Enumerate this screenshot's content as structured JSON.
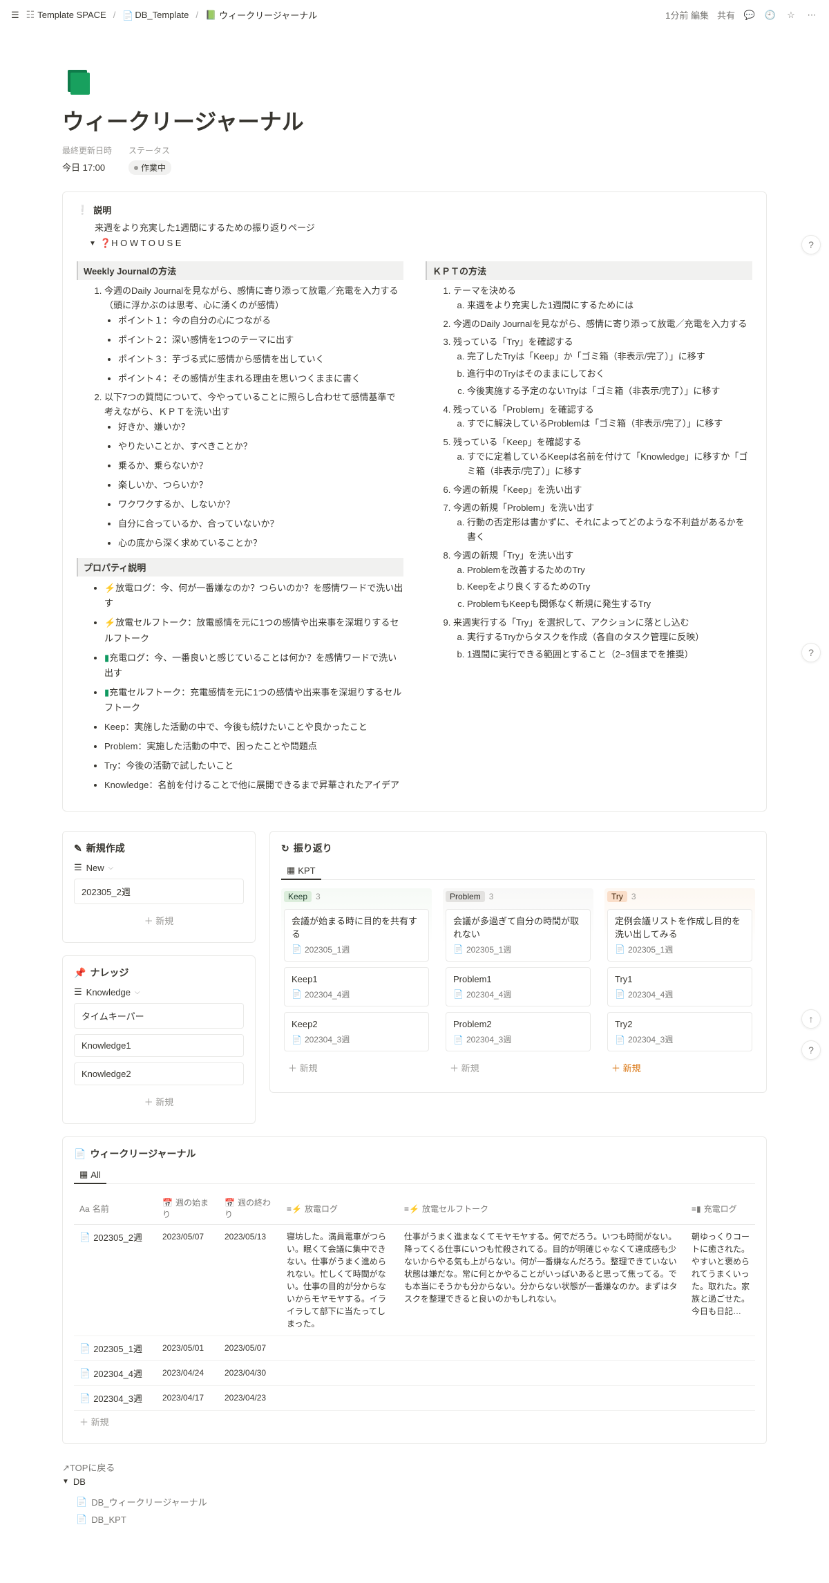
{
  "breadcrumb": [
    {
      "icon": "stack",
      "label": "Template SPACE"
    },
    {
      "icon": "doc",
      "label": "DB_Template"
    },
    {
      "icon": "journal",
      "label": "ウィークリージャーナル"
    }
  ],
  "topbar": {
    "time": "1分前 編集",
    "share": "共有"
  },
  "page": {
    "title": "ウィークリージャーナル"
  },
  "props": {
    "updated_label": "最終更新日時",
    "updated_value": "今日 17:00",
    "status_label": "ステータス",
    "status_value": "作業中"
  },
  "callout": {
    "head": "説明",
    "sub": "来週をより充実した1週間にするための振り返りページ",
    "toggle": "❓H O W  T O  U S E"
  },
  "left": {
    "section1": "Weekly Journalの方法",
    "items1": [
      "今週のDaily Journalを見ながら、感情に寄り添って放電／充電を入力する（頭に浮かぶのは思考、心に湧くのが感情）",
      "以下7つの質問について、今やっていることに照らし合わせて感情基準で考えながら、ＫＰＴを洗い出す"
    ],
    "points": [
      "ポイント１：今の自分の心につながる",
      "ポイント２：深い感情を1つのテーマに出す",
      "ポイント３：芋づる式に感情から感情を出していく",
      "ポイント４：その感情が生まれる理由を思いつくままに書く"
    ],
    "questions": [
      "好きか、嫌いか？",
      "やりたいことか、すべきことか？",
      "乗るか、乗らないか？",
      "楽しいか、つらいか？",
      "ワクワクするか、しないか？",
      "自分に合っているか、合っていないか？",
      "心の底から深く求めていることか？"
    ],
    "section2": "プロパティ説明",
    "props": [
      {
        "pre": "⚡",
        "cls": "bolt",
        "text": "放電ログ：今、何が一番嫌なのか？つらいのか？を感情ワードで洗い出す"
      },
      {
        "pre": "⚡",
        "cls": "bolt",
        "text": "放電セルフトーク：放電感情を元に1つの感情や出来事を深堀りするセルフトーク"
      },
      {
        "pre": "▮",
        "cls": "plug-green",
        "text": "充電ログ：今、一番良いと感じていることは何か？を感情ワードで洗い出す"
      },
      {
        "pre": "▮",
        "cls": "plug-green",
        "text": "充電セルフトーク：充電感情を元に1つの感情や出来事を深堀りするセルフトーク"
      },
      {
        "pre": "",
        "cls": "",
        "text": "Keep：実施した活動の中で、今後も続けたいことや良かったこと"
      },
      {
        "pre": "",
        "cls": "",
        "text": "Problem：実施した活動の中で、困ったことや問題点"
      },
      {
        "pre": "",
        "cls": "",
        "text": "Try：今後の活動で試したいこと"
      },
      {
        "pre": "",
        "cls": "",
        "text": "Knowledge：名前を付けることで他に展開できるまで昇華されたアイデア"
      }
    ]
  },
  "right": {
    "section": "ＫＰＴの方法",
    "items": [
      {
        "t": "テーマを決める",
        "sub": [
          "来週をより充実した1週間にするためには"
        ]
      },
      {
        "t": "今週のDaily Journalを見ながら、感情に寄り添って放電／充電を入力する",
        "sub": []
      },
      {
        "t": "残っている「Try」を確認する",
        "sub": [
          "完了したTryは「Keep」か「ゴミ箱（非表示/完了）」に移す",
          "進行中のTryはそのままにしておく",
          "今後実施する予定のないTryは「ゴミ箱（非表示/完了）」に移す"
        ]
      },
      {
        "t": "残っている「Problem」を確認する",
        "sub": [
          "すでに解決しているProblemは「ゴミ箱（非表示/完了）」に移す"
        ]
      },
      {
        "t": "残っている「Keep」を確認する",
        "sub": [
          "すでに定着しているKeepは名前を付けて「Knowledge」に移すか「ゴミ箱（非表示/完了）」に移す"
        ]
      },
      {
        "t": "今週の新規「Keep」を洗い出す",
        "sub": []
      },
      {
        "t": "今週の新規「Problem」を洗い出す",
        "sub": [
          "行動の否定形は書かずに、それによってどのような不利益があるかを書く"
        ]
      },
      {
        "t": "今週の新規「Try」を洗い出す",
        "sub": [
          "Problemを改善するためのTry",
          "Keepをより良くするためのTry",
          "ProblemもKeepも関係なく新規に発生するTry"
        ]
      },
      {
        "t": "来週実行する「Try」を選択して、アクションに落とし込む",
        "sub": [
          "実行するTryからタスクを作成（各自のタスク管理に反映）",
          "1週間に実行できる範囲とすること（2~3個までを推奨）"
        ]
      }
    ]
  },
  "newcard": {
    "title": "新規作成",
    "view": "New",
    "item": "202305_2週",
    "new": "＋ 新規"
  },
  "knowledgecard": {
    "title": "ナレッジ",
    "view": "Knowledge",
    "items": [
      "タイムキーパー",
      "Knowledge1",
      "Knowledge2"
    ],
    "new": "＋ 新規"
  },
  "kpt": {
    "title": "振り返り",
    "tab": "KPT",
    "cols": [
      {
        "tag": "Keep",
        "tagcls": "tag-keep",
        "count": "3",
        "wrap": "col-bg-keep",
        "items": [
          {
            "title": "会議が始まる時に目的を共有する",
            "link": "202305_1週"
          },
          {
            "title": "Keep1",
            "link": "202304_4週"
          },
          {
            "title": "Keep2",
            "link": "202304_3週"
          }
        ]
      },
      {
        "tag": "Problem",
        "tagcls": "tag-problem",
        "count": "3",
        "wrap": "col-bg-prob",
        "items": [
          {
            "title": "会議が多過ぎて自分の時間が取れない",
            "link": "202305_1週"
          },
          {
            "title": "Problem1",
            "link": "202304_4週"
          },
          {
            "title": "Problem2",
            "link": "202304_3週"
          }
        ]
      },
      {
        "tag": "Try",
        "tagcls": "tag-try",
        "count": "3",
        "wrap": "col-bg-try",
        "newcls": "new-red",
        "items": [
          {
            "title": "定例会議リストを作成し目的を洗い出してみる",
            "link": "202305_1週"
          },
          {
            "title": "Try1",
            "link": "202304_4週"
          },
          {
            "title": "Try2",
            "link": "202304_3週"
          }
        ]
      }
    ],
    "new": "＋ 新規"
  },
  "table": {
    "title": "ウィークリージャーナル",
    "tab": "All",
    "cols": [
      "名前",
      "週の始まり",
      "週の終わり",
      "放電ログ",
      "放電セルフトーク",
      "充電ログ"
    ],
    "col_icons": [
      "Aa",
      "📅",
      "📅",
      "≡⚡",
      "≡⚡",
      "≡▮"
    ],
    "rows": [
      {
        "name": "202305_2週",
        "start": "2023/05/07",
        "end": "2023/05/13",
        "log": "寝坊した。満員電車がつらい。眠くて会議に集中できない。仕事がうまく進められない。忙しくて時間がない。仕事の目的が分からないからモヤモヤする。イライラして部下に当たってしまった。",
        "self": "仕事がうまく進まなくてモヤモヤする。何でだろう。いつも時間がない。降ってくる仕事にいつも忙殺されてる。目的が明確じゃなくて達成感も少ないからやる気も上がらない。何が一番嫌なんだろう。整理できていない状態は嫌だな。常に何とかやることがいっぱいあると思って焦ってる。でも本当にそうかも分からない。分からない状態が一番嫌なのか。まずはタスクを整理できると良いのかもしれない。",
        "charge": "朝ゆっくりコートに癒された。やすいと褒められてうまくいった。取れた。家族と過ごせた。今日も日記…"
      },
      {
        "name": "202305_1週",
        "start": "2023/05/01",
        "end": "2023/05/07",
        "log": "",
        "self": "",
        "charge": ""
      },
      {
        "name": "202304_4週",
        "start": "2023/04/24",
        "end": "2023/04/30",
        "log": "",
        "self": "",
        "charge": ""
      },
      {
        "name": "202304_3週",
        "start": "2023/04/17",
        "end": "2023/04/23",
        "log": "",
        "self": "",
        "charge": ""
      }
    ],
    "new": "＋ 新規"
  },
  "footer": {
    "top": "↗TOPに戻る",
    "db": "DB",
    "items": [
      "DB_ウィークリージャーナル",
      "DB_KPT"
    ]
  }
}
